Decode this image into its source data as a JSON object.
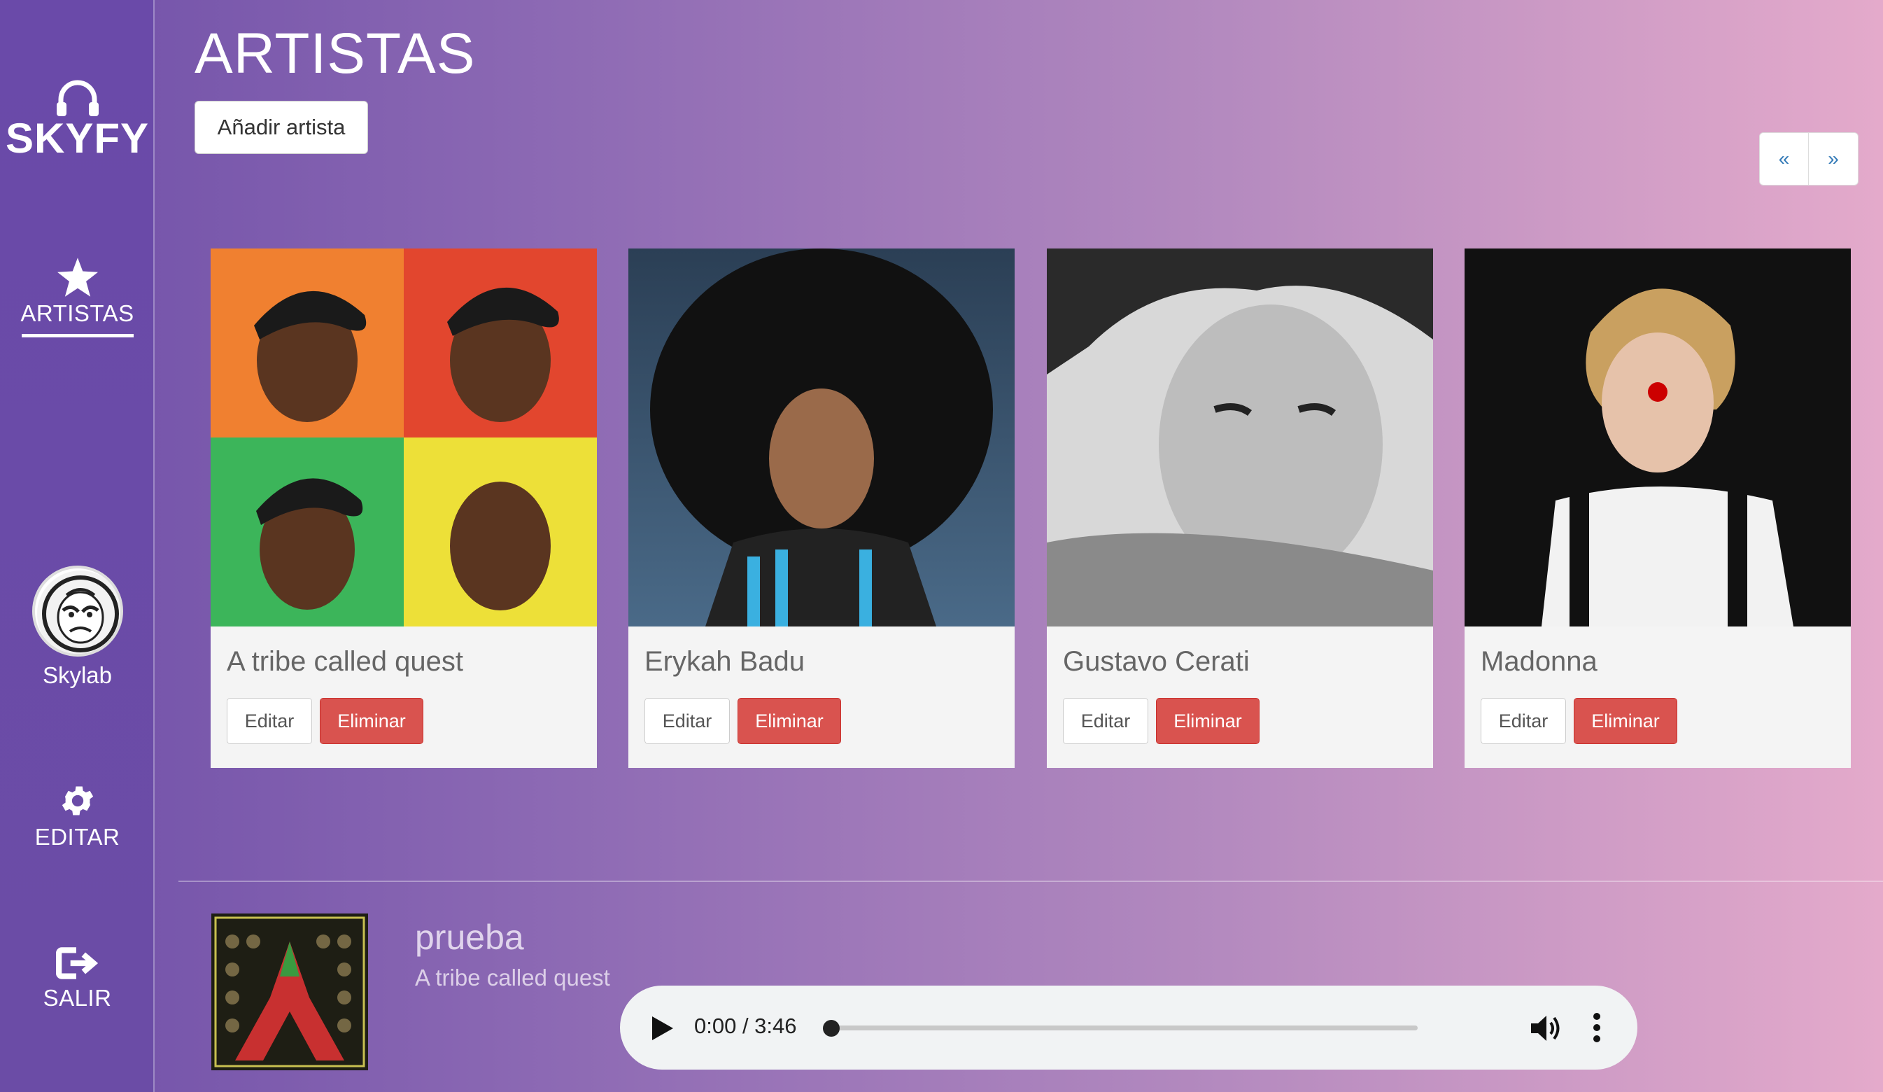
{
  "sidebar": {
    "logo": "SKYFY",
    "nav": {
      "artistas": "ARTISTAS",
      "editar": "EDITAR",
      "salir": "SALIR"
    },
    "user": {
      "name": "Skylab"
    }
  },
  "header": {
    "title": "ARTISTAS",
    "add_button": "Añadir artista",
    "pager": {
      "prev": "«",
      "next": "»"
    }
  },
  "artists": [
    {
      "name": "A tribe called quest",
      "edit": "Editar",
      "delete": "Eliminar"
    },
    {
      "name": "Erykah Badu",
      "edit": "Editar",
      "delete": "Eliminar"
    },
    {
      "name": "Gustavo Cerati",
      "edit": "Editar",
      "delete": "Eliminar"
    },
    {
      "name": "Madonna",
      "edit": "Editar",
      "delete": "Eliminar"
    }
  ],
  "player": {
    "title": "prueba",
    "artist": "A tribe called quest",
    "time": "0:00 / 3:46",
    "progress": 0
  },
  "colors": {
    "sidebar": "#6a4aa9",
    "danger": "#d9534f",
    "link": "#337ab7"
  }
}
